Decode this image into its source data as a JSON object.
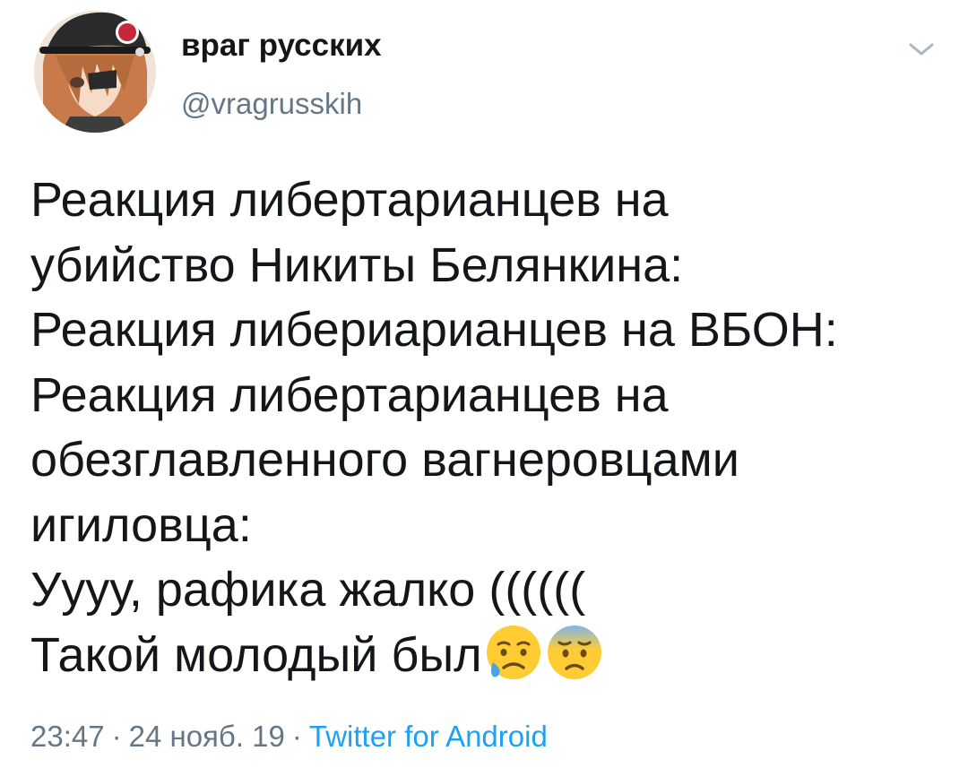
{
  "author": {
    "display_name": "враг русских",
    "handle": "@vragrusskih",
    "avatar_icon": "anime-character-avatar"
  },
  "menu": {
    "icon": "chevron-down-icon"
  },
  "tweet": {
    "lines": [
      "Реакция либертарианцев на",
      "убийство Никиты Белянкина:",
      "Реакция либериарианцев на ВБОН:",
      "Реакция либертарианцев на",
      "обезглавленного вагнеровцами",
      "игиловца:",
      "Уууу, рафика жалко ((((((",
      "Такой молодый был"
    ],
    "emojis": [
      "sad-relieved-face-emoji",
      "anxious-face-with-sweat-emoji"
    ]
  },
  "meta": {
    "time": "23:47",
    "date": "24 нояб. 19",
    "separator": "·",
    "source": "Twitter for Android"
  },
  "colors": {
    "text": "#14171a",
    "secondary": "#657786",
    "link": "#1da1f2"
  }
}
